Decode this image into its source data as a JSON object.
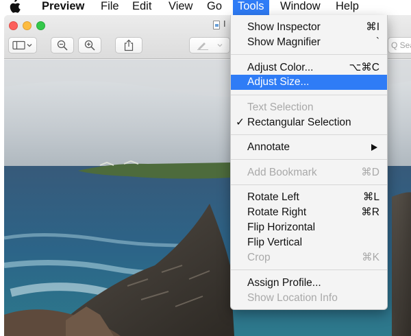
{
  "menubar": {
    "app_name": "Preview",
    "items": [
      "File",
      "Edit",
      "View",
      "Go",
      "Tools",
      "Window",
      "Help"
    ]
  },
  "window": {
    "title_fragment": "I",
    "search_placeholder": "Q Sea"
  },
  "tools_menu": {
    "show_inspector": {
      "label": "Show Inspector",
      "shortcut": "⌘I"
    },
    "show_magnifier": {
      "label": "Show Magnifier",
      "shortcut": "`"
    },
    "adjust_color": {
      "label": "Adjust Color...",
      "shortcut": "⌥⌘C"
    },
    "adjust_size": {
      "label": "Adjust Size..."
    },
    "text_selection": {
      "label": "Text Selection"
    },
    "rectangular_selection": {
      "label": "Rectangular Selection",
      "check": "✓"
    },
    "annotate": {
      "label": "Annotate"
    },
    "add_bookmark": {
      "label": "Add Bookmark",
      "shortcut": "⌘D"
    },
    "rotate_left": {
      "label": "Rotate Left",
      "shortcut": "⌘L"
    },
    "rotate_right": {
      "label": "Rotate Right",
      "shortcut": "⌘R"
    },
    "flip_horizontal": {
      "label": "Flip Horizontal"
    },
    "flip_vertical": {
      "label": "Flip Vertical"
    },
    "crop": {
      "label": "Crop",
      "shortcut": "⌘K"
    },
    "assign_profile": {
      "label": "Assign Profile..."
    },
    "show_location_info": {
      "label": "Show Location Info"
    }
  },
  "colors": {
    "accent": "#2f7cf6",
    "close": "#fc605c",
    "minimize": "#fdbc40",
    "zoom": "#34c84a"
  }
}
